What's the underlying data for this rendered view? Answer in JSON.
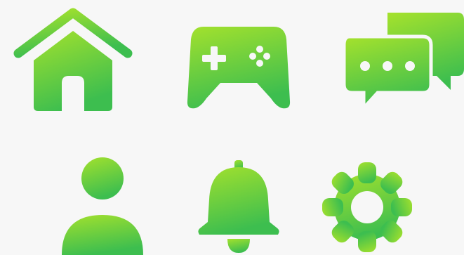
{
  "colors": {
    "background": "#f7f7f7",
    "gradient_top": "#a3e12d",
    "gradient_bottom": "#3dbe4f",
    "cutout": "#f7f7f7"
  },
  "icons": [
    {
      "name": "home-icon"
    },
    {
      "name": "gamepad-icon"
    },
    {
      "name": "chat-bubbles-icon"
    },
    {
      "name": "user-icon"
    },
    {
      "name": "bell-icon"
    },
    {
      "name": "gear-icon"
    }
  ]
}
